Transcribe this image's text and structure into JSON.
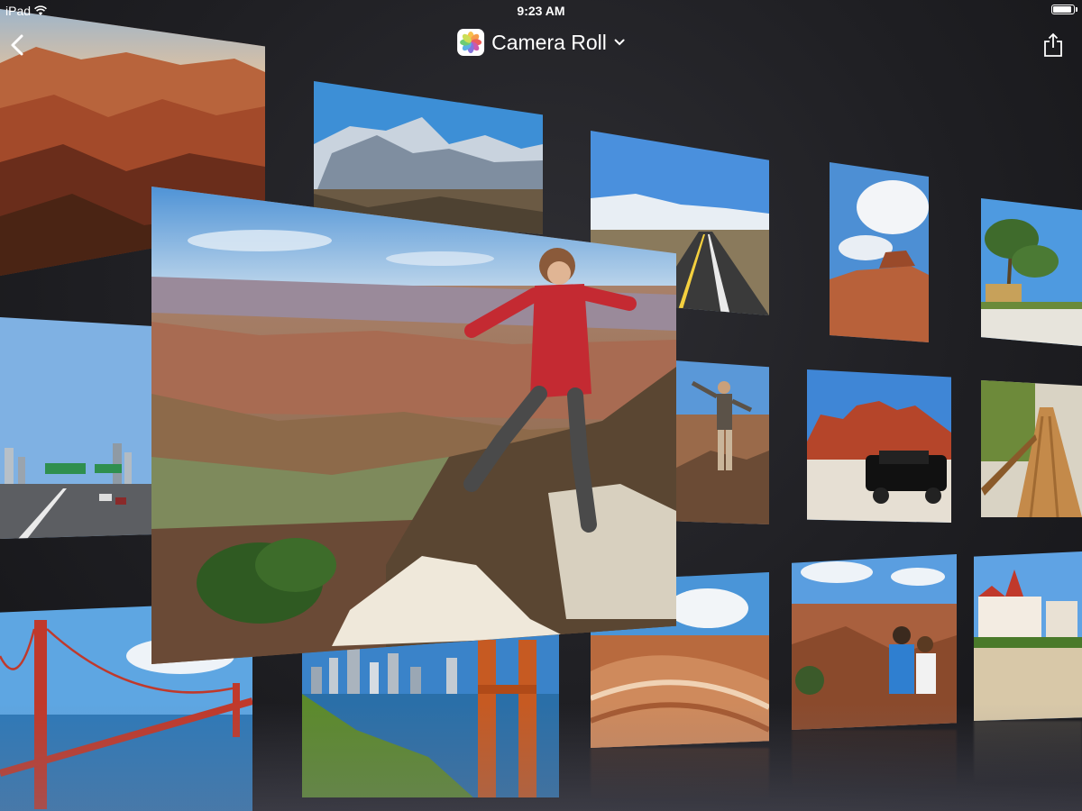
{
  "status_bar": {
    "device": "iPad",
    "time": "9:23 AM",
    "wifi_icon": "wifi-icon",
    "battery_icon": "battery-icon"
  },
  "nav_bar": {
    "back_icon": "chevron-left-icon",
    "app_icon": "photos-app-icon",
    "title": "Camera Roll",
    "title_dropdown_icon": "chevron-down-icon",
    "share_icon": "share-icon"
  },
  "album": {
    "featured_photo": "grand-canyon-jumper",
    "photos": [
      "grand-canyon-vista",
      "snowy-mountains",
      "desert-highway",
      "red-rock-sky",
      "palm-beach-house",
      "city-freeway",
      "hiker-on-cliff",
      "jeep-red-rocks",
      "boardwalk-stairs",
      "golden-gate-bridge",
      "sf-skyline-bridge",
      "wave-rock-formation",
      "couple-canyon",
      "coronado-hotel"
    ]
  },
  "colors": {
    "background": "#1f1f23",
    "text": "#ffffff"
  }
}
